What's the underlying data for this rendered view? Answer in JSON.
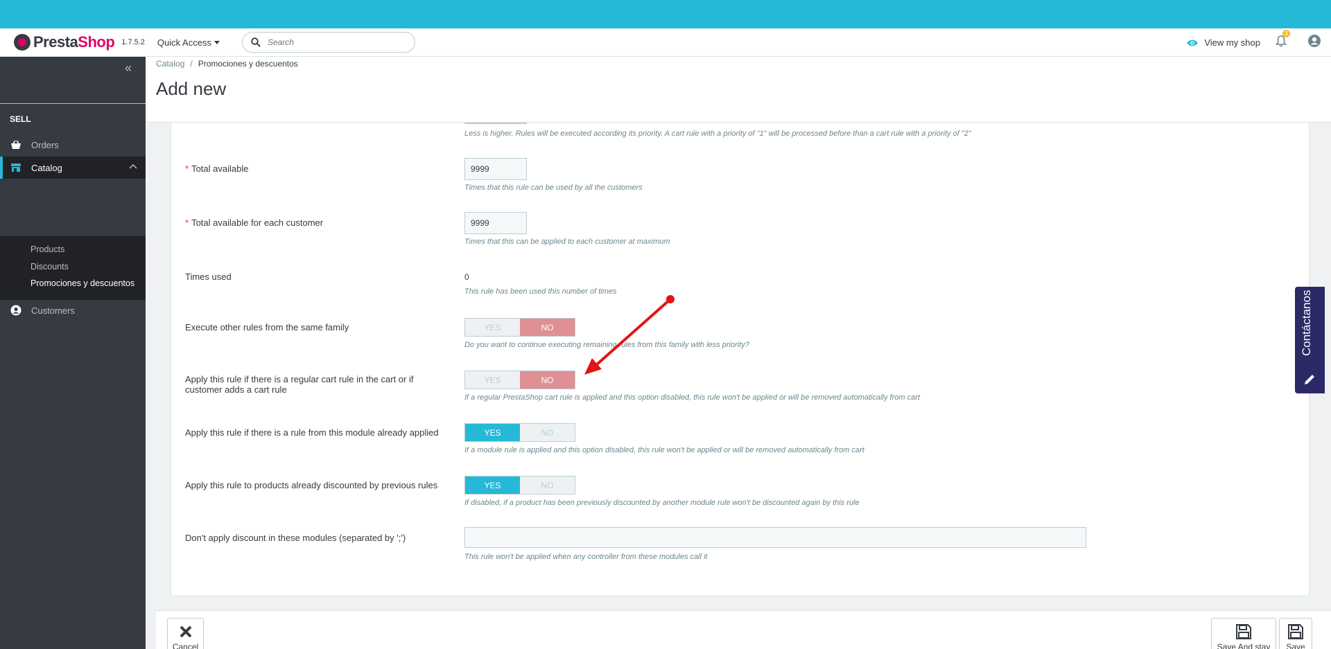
{
  "header": {
    "brand_main": "Presta",
    "brand_accent": "Shop",
    "version": "1.7.5.2",
    "quick_access": "Quick Access",
    "search_placeholder": "Search",
    "view_shop": "View my shop",
    "notif_count": "3"
  },
  "sidebar": {
    "section_title": "SELL",
    "items": [
      {
        "label": "Orders",
        "icon": "basket-icon"
      },
      {
        "label": "Catalog",
        "icon": "store-icon"
      },
      {
        "label": "Customers",
        "icon": "account-circle-icon"
      }
    ],
    "catalog_sub": [
      "Products",
      "Discounts",
      "Promociones y descuentos"
    ]
  },
  "breadcrumb": {
    "parent": "Catalog",
    "current": "Promociones y descuentos"
  },
  "page_title": "Add new",
  "form": {
    "priority_help": "Less is higher. Rules will be executed according its priority. A cart rule with a priority of \"1\" will be processed before than a cart rule with a priority of \"2\"",
    "total_available": {
      "label": "Total available",
      "value": "9999",
      "help": "Times that this rule can be used by all the customers"
    },
    "total_per_customer": {
      "label": "Total available for each customer",
      "value": "9999",
      "help": "Times that this can be applied to each customer at maximum"
    },
    "times_used": {
      "label": "Times used",
      "value": "0",
      "help": "This rule has been used this number of times"
    },
    "execute_other": {
      "label": "Execute other rules from the same family",
      "help": "Do you want to continue executing remaining rules from this family with less priority?",
      "selected": "NO"
    },
    "apply_regular": {
      "label_line1": "Apply this rule if there is a regular cart rule in the cart or if",
      "label_line2": "customer adds a cart rule",
      "help": "If a regular PrestaShop cart rule is applied and this option disabled, this rule won't be applied or will be removed automatically from cart",
      "selected": "NO"
    },
    "apply_module": {
      "label": "Apply this rule if there is a rule from this module already applied",
      "help": "If a module rule is applied and this option disabled, this rule won't be applied or will be removed automatically from cart",
      "selected": "YES"
    },
    "apply_discounted": {
      "label": "Apply this rule to products already discounted by previous rules",
      "help": "If disabled, if a product has been previously discounted by another module rule won't be discounted again by this rule",
      "selected": "YES"
    },
    "modules": {
      "label": "Don't apply discount in these modules (separated by ';')",
      "value": "",
      "help": "This rule won't be applied when any controller from these modules call it"
    },
    "yes_label": "YES",
    "no_label": "NO"
  },
  "footer": {
    "cancel": "Cancel",
    "save_and_stay": "Save And stay",
    "save": "Save"
  },
  "contact_tab": "Contáctanos",
  "colors": {
    "accent": "#25b9d7",
    "sidebar": "#363a41",
    "no_active": "#e08f95",
    "contact": "#2b2a67",
    "annotation_arrow": "#e31414"
  }
}
